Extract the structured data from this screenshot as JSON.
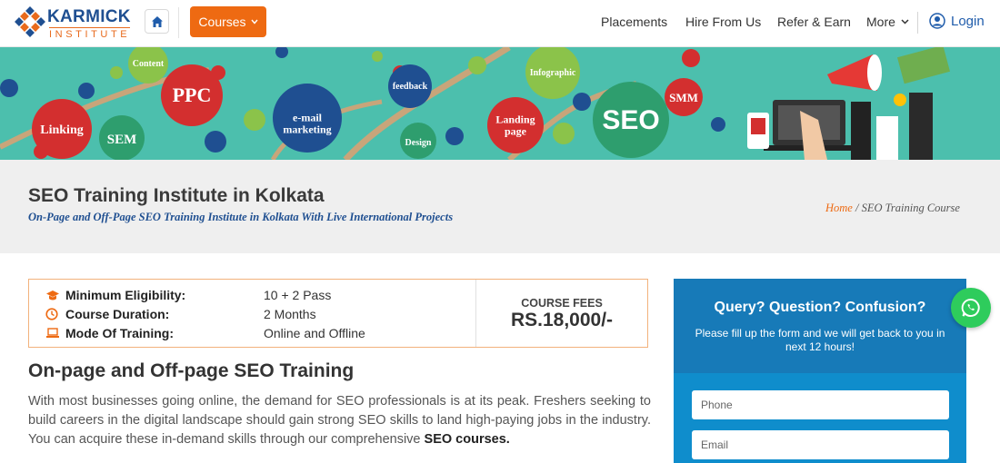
{
  "header": {
    "logo_name": "KARMICK",
    "logo_sub": "INSTITUTE",
    "courses_label": "Courses",
    "nav": [
      "Placements",
      "Hire From Us",
      "Refer & Earn",
      "More"
    ],
    "login_label": "Login"
  },
  "banner": {
    "bubbles": [
      "Content",
      "PPC",
      "Linking",
      "SEM",
      "e-mail marketing",
      "feedback",
      "Infographic",
      "Design",
      "Landing page",
      "SEO",
      "SMM"
    ]
  },
  "title_band": {
    "title": "SEO Training Institute in Kolkata",
    "subtitle": "On-Page and Off-Page SEO Training Institute in Kolkata With Live International Projects",
    "breadcrumb_home": "Home",
    "breadcrumb_current": "/ SEO Training Course"
  },
  "info": {
    "rows": [
      {
        "label": "Minimum Eligibility:",
        "value": "10 + 2 Pass"
      },
      {
        "label": "Course Duration:",
        "value": "2 Months"
      },
      {
        "label": "Mode Of Training:",
        "value": "Online and Offline"
      }
    ],
    "fees_label": "COURSE FEES",
    "fees_value": "RS.18,000/-"
  },
  "content": {
    "heading": "On-page and Off-page SEO Training",
    "para_text": "With most businesses going online, the demand for SEO professionals is at its peak. Freshers seeking to build careers in the digital landscape should gain strong SEO skills to land high-paying jobs in the industry. You can acquire these in-demand skills through our comprehensive ",
    "para_bold": "SEO courses."
  },
  "query": {
    "title": "Query? Question? Confusion?",
    "subtitle": "Please fill up the form and we will get back to you in next 12 hours!",
    "phone_placeholder": "Phone",
    "email_placeholder": "Email"
  },
  "colors": {
    "accent": "#ee6a12",
    "brand": "#1f4f91",
    "banner": "#4cbfad",
    "form": "#177ab8",
    "whatsapp": "#2ecc5c"
  }
}
